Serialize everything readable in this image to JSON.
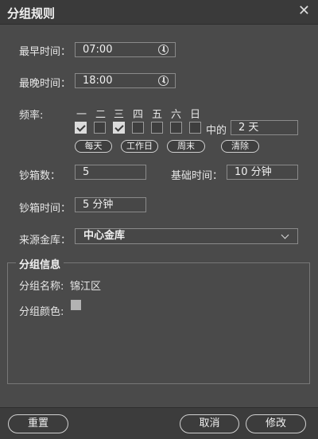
{
  "dialog": {
    "title": "分组规则",
    "close_glyph": "✕"
  },
  "fields": {
    "earliest_label": "最早时间：",
    "earliest_value": "07:00",
    "latest_label": "最晚时间：",
    "latest_value": "18:00",
    "frequency_label": "频率:",
    "days": [
      "一",
      "二",
      "三",
      "四",
      "五",
      "六",
      "日"
    ],
    "days_checked": [
      true,
      false,
      true,
      false,
      false,
      false,
      false
    ],
    "in_label": "中的",
    "in_value": "2 天",
    "quick_buttons": [
      "每天",
      "工作日",
      "周末",
      "清除"
    ],
    "cashbox_count_label": "钞箱数：",
    "cashbox_count_value": "5",
    "base_time_label": "基础时间：",
    "base_time_value": "10 分钟",
    "cashbox_time_label": "钞箱时间：",
    "cashbox_time_value": "5 分钟",
    "source_vault_label": "来源金库：",
    "source_vault_value": "中心金库"
  },
  "group_info": {
    "legend": "分组信息",
    "name_label": "分组名称:",
    "name_value": "锦江区",
    "color_label": "分组颜色:",
    "color_value": "#b3b3b3"
  },
  "footer": {
    "reset": "重置",
    "cancel": "取消",
    "modify": "修改"
  }
}
